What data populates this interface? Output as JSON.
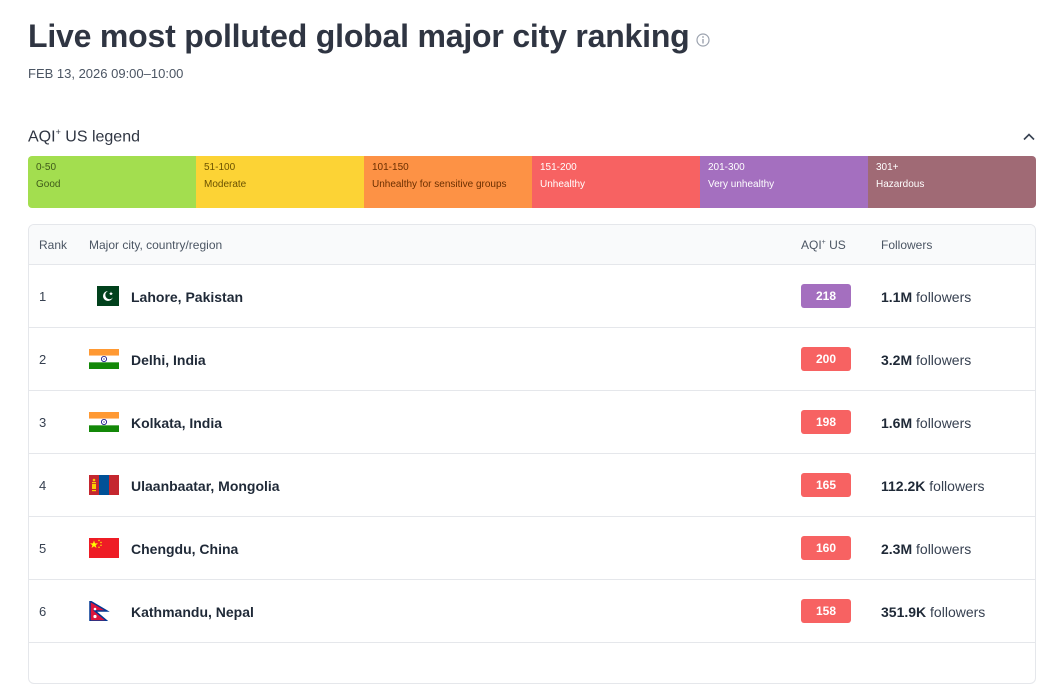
{
  "header": {
    "title": "Live most polluted global major city ranking",
    "timestamp": "FEB 13, 2026 09:00–10:00"
  },
  "legend": {
    "title_main": "AQI",
    "title_sup": "+",
    "title_rest": " US legend",
    "segments": [
      {
        "range": "0-50",
        "label": "Good",
        "color": "#a3de4f",
        "text_color": "#3f5a1a"
      },
      {
        "range": "51-100",
        "label": "Moderate",
        "color": "#fcd335",
        "text_color": "#6b5200"
      },
      {
        "range": "101-150",
        "label": "Unhealthy for sensitive groups",
        "color": "#fd9245",
        "text_color": "#6b2f00"
      },
      {
        "range": "151-200",
        "label": "Unhealthy",
        "color": "#f76262",
        "text_color": "#ffffff"
      },
      {
        "range": "201-300",
        "label": "Very unhealthy",
        "color": "#a46fbf",
        "text_color": "#ffffff"
      },
      {
        "range": "301+",
        "label": "Hazardous",
        "color": "#a06a75",
        "text_color": "#ffffff"
      }
    ]
  },
  "table": {
    "headers": {
      "rank": "Rank",
      "city": "Major city, country/region",
      "aqi_main": "AQI",
      "aqi_sup": "+",
      "aqi_rest": " US",
      "followers": "Followers"
    },
    "rows": [
      {
        "rank": "1",
        "flag": "pakistan-flag",
        "city": "Lahore, Pakistan",
        "aqi": "218",
        "aqi_color": "#a46fbf",
        "followers_count": "1.1M",
        "followers_suffix": " followers"
      },
      {
        "rank": "2",
        "flag": "india-flag",
        "city": "Delhi, India",
        "aqi": "200",
        "aqi_color": "#f76262",
        "followers_count": "3.2M",
        "followers_suffix": " followers"
      },
      {
        "rank": "3",
        "flag": "india-flag",
        "city": "Kolkata, India",
        "aqi": "198",
        "aqi_color": "#f76262",
        "followers_count": "1.6M",
        "followers_suffix": " followers"
      },
      {
        "rank": "4",
        "flag": "mongolia-flag",
        "city": "Ulaanbaatar, Mongolia",
        "aqi": "165",
        "aqi_color": "#f76262",
        "followers_count": "112.2K",
        "followers_suffix": " followers"
      },
      {
        "rank": "5",
        "flag": "china-flag",
        "city": "Chengdu, China",
        "aqi": "160",
        "aqi_color": "#f76262",
        "followers_count": "2.3M",
        "followers_suffix": " followers"
      },
      {
        "rank": "6",
        "flag": "nepal-flag",
        "city": "Kathmandu, Nepal",
        "aqi": "158",
        "aqi_color": "#f76262",
        "followers_count": "351.9K",
        "followers_suffix": " followers"
      }
    ]
  }
}
